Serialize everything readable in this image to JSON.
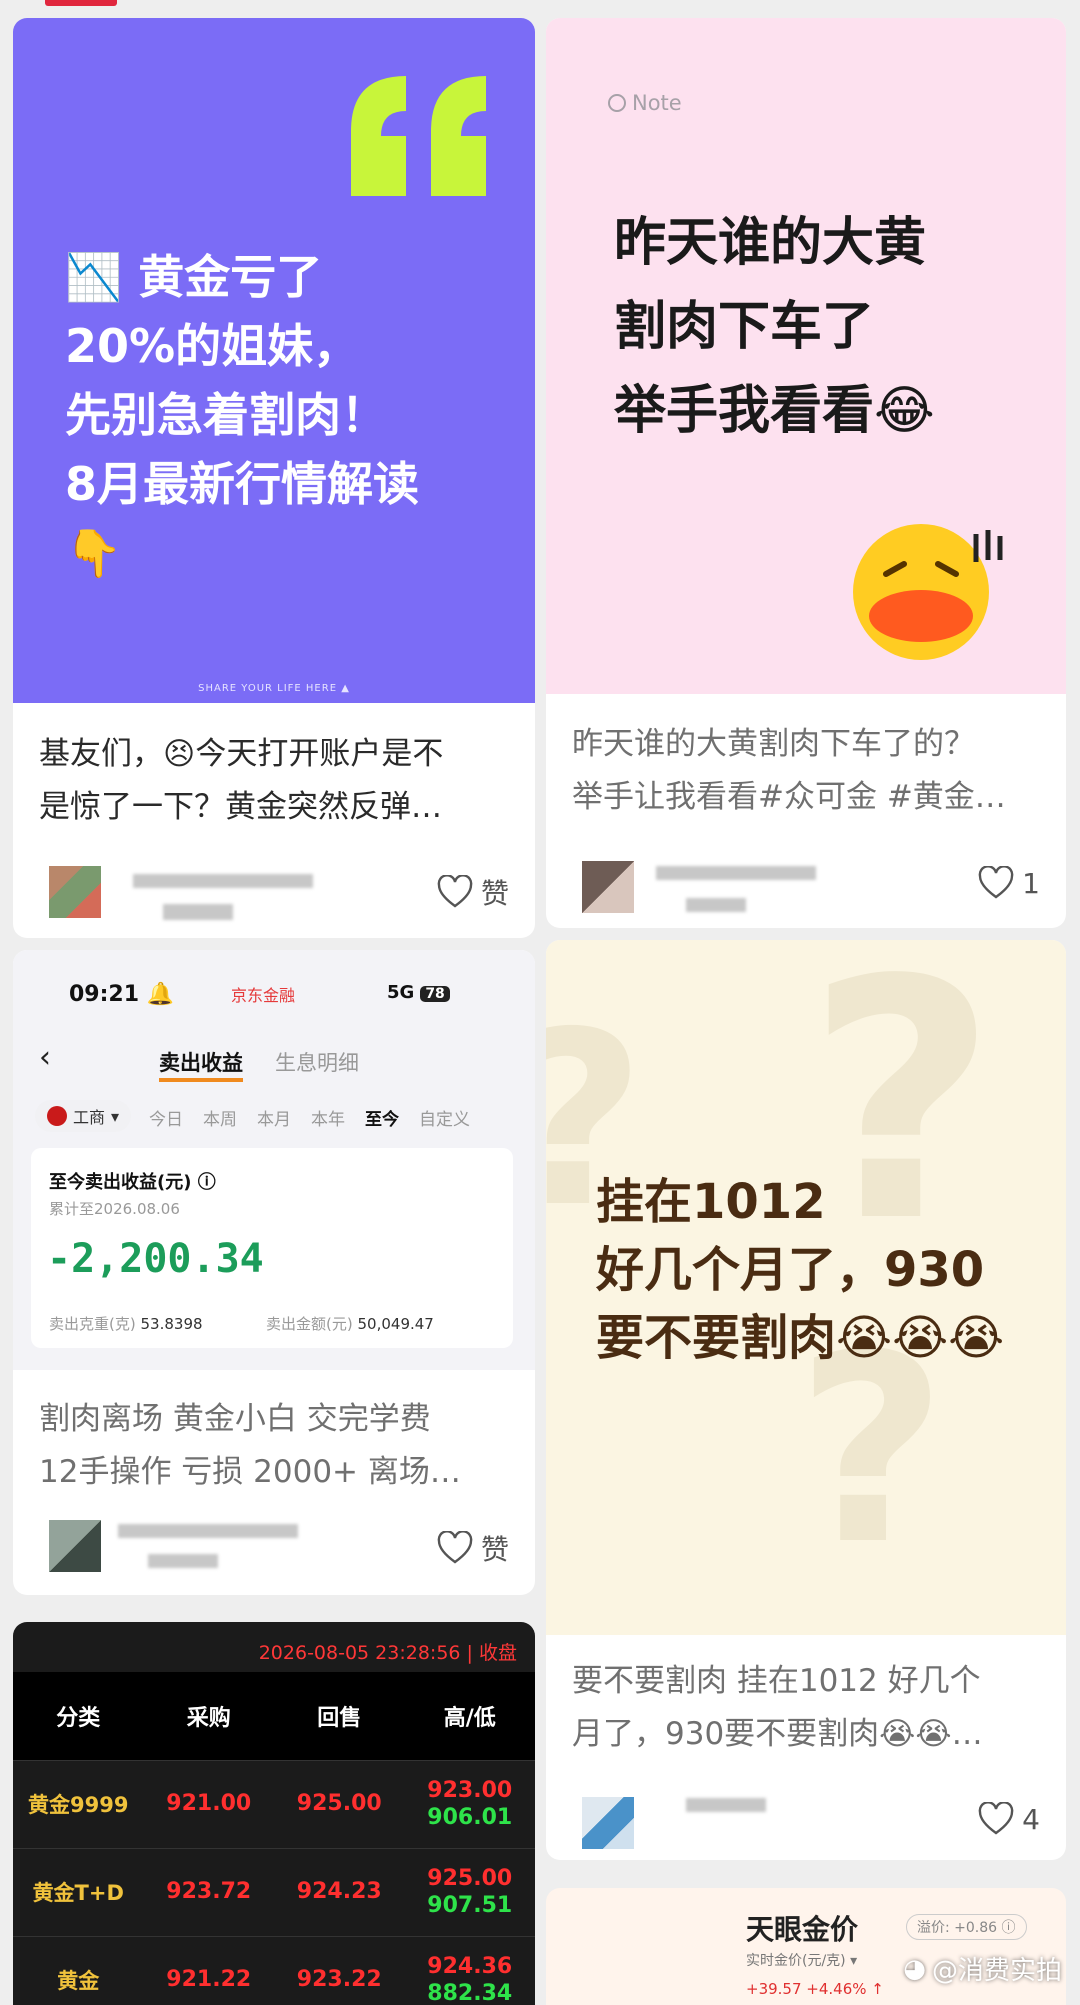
{
  "feed": {
    "card1": {
      "image_lines": [
        "📉 黄金亏了",
        "20%的姐妹，",
        "先别急着割肉！",
        "8月最新行情解读"
      ],
      "image_gold_word": "黄金",
      "image_footer": "SHARE YOUR LIFE HERE ▲",
      "title": "基友们，😣今天打开账户是不\n是惊了一下？黄金突然反弹…",
      "like_label": "赞"
    },
    "card2": {
      "note_label": "Note",
      "image_lines": [
        "昨天谁的大黄",
        "割肉下车了",
        "举手我看看😂"
      ],
      "title": "昨天谁的大黄割肉下车了的？\n举手让我看看#众可金 #黄金…",
      "like_count": "1"
    },
    "card3": {
      "status_time": "09:21 🔔",
      "status_app": "京东金融",
      "status_signal": "5G",
      "status_battery": "78",
      "back": "‹",
      "tab_active": "卖出收益",
      "tab_inactive": "生息明细",
      "bank": "工商",
      "periods": [
        "今日",
        "本周",
        "本月",
        "本年",
        "至今",
        "自定义"
      ],
      "active_period": "至今",
      "summary_title": "至今卖出收益(元) ⓘ",
      "summary_sub": "累计至2026.08.06",
      "summary_amount": "-2,200.34",
      "weight_label": "卖出克重(克)",
      "weight_value": "53.8398",
      "sum_label": "卖出金额(元)",
      "sum_value": "50,049.47",
      "title": "割肉离场 黄金小白 交完学费\n12手操作 亏损 2000+ 离场…",
      "like_label": "赞"
    },
    "card4": {
      "image_text": "挂在1012\n好几个月了，930\n要不要割肉😭😭😭",
      "title": "要不要割肉 挂在1012 好几个\n月了，930要不要割肉😭😭…",
      "like_count": "4"
    },
    "card5": {
      "timestamp": "2026-08-05 23:28:56 | 收盘",
      "headers": [
        "分类",
        "采购",
        "回售",
        "高/低"
      ],
      "rows": [
        {
          "name": "黄金9999",
          "buy": "921.00",
          "sell": "925.00",
          "high": "923.00",
          "low": "906.01"
        },
        {
          "name": "黄金T+D",
          "buy": "923.72",
          "sell": "924.23",
          "high": "925.00",
          "low": "907.51"
        },
        {
          "name": "黄金",
          "buy": "921.22",
          "sell": "923.22",
          "high": "924.36",
          "low": "882.34"
        }
      ]
    },
    "card6": {
      "title": "天眼金价",
      "subtitle": "实时金价(元/克) ▾",
      "pill": "溢价: +0.86 ⓘ",
      "delta": "+39.57 +4.46% ↑"
    }
  },
  "watermark": "@消费实拍",
  "colors": {
    "purple_bg": "#7b6cf6",
    "pink_bg": "#fde1ef",
    "cream_bg": "#fbf5e2",
    "loss_green": "#1c9d5a",
    "quote_red": "#ff2f2f",
    "quote_green": "#2ee34a"
  }
}
